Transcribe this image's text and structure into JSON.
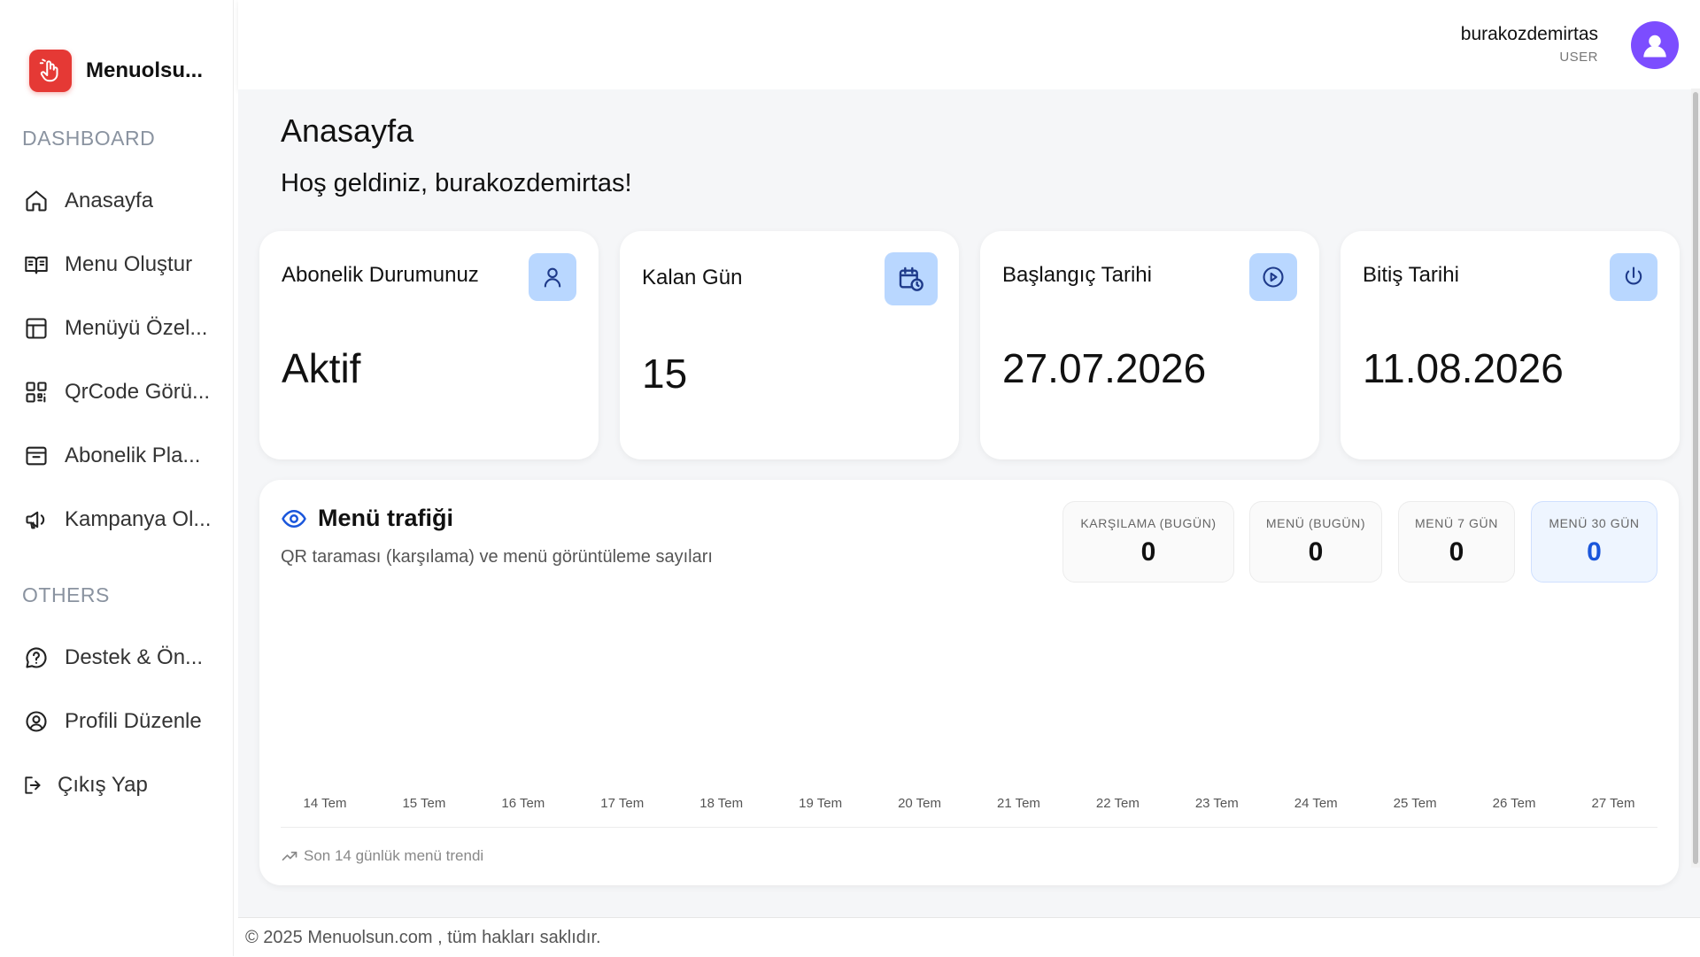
{
  "brand": {
    "name": "Menuolsu...",
    "color": "#e53935"
  },
  "sidebar": {
    "sections": [
      {
        "label": "DASHBOARD"
      },
      {
        "label": "OTHERS"
      }
    ],
    "items": [
      {
        "label": "Anasayfa",
        "icon": "home-icon"
      },
      {
        "label": "Menu Oluştur",
        "icon": "book-icon"
      },
      {
        "label": "Menüyü Özel...",
        "icon": "layout-icon"
      },
      {
        "label": "QrCode Görü...",
        "icon": "qrcode-icon"
      },
      {
        "label": "Abonelik Pla...",
        "icon": "archive-icon"
      },
      {
        "label": "Kampanya Ol...",
        "icon": "megaphone-icon"
      },
      {
        "label": "Destek & Ön...",
        "icon": "help-icon"
      },
      {
        "label": "Profili Düzenle",
        "icon": "user-circle-icon"
      },
      {
        "label": "Çıkış Yap",
        "icon": "logout-icon"
      }
    ]
  },
  "header": {
    "user_name": "burakozdemirtas",
    "user_role": "USER",
    "avatar_color": "#7c4dff"
  },
  "main": {
    "title": "Anasayfa",
    "welcome": "Hoş geldiniz, burakozdemirtas!"
  },
  "stats": [
    {
      "label": "Abonelik Durumunuz",
      "value": "Aktif",
      "icon": "user-icon"
    },
    {
      "label": "Kalan Gün",
      "value": "15",
      "icon": "calendar-clock-icon"
    },
    {
      "label": "Başlangıç Tarihi",
      "value": "27.07.2026",
      "icon": "play-circle-icon"
    },
    {
      "label": "Bitiş Tarihi",
      "value": "11.08.2026",
      "icon": "power-icon"
    }
  ],
  "traffic": {
    "title": "Menü trafiği",
    "subtitle": "QR taraması (karşılama) ve menü görüntüleme sayıları",
    "metrics": [
      {
        "label": "KARŞILAMA (BUGÜN)",
        "value": "0"
      },
      {
        "label": "MENÜ (BUGÜN)",
        "value": "0"
      },
      {
        "label": "MENÜ 7 GÜN",
        "value": "0"
      },
      {
        "label": "MENÜ 30 GÜN",
        "value": "0"
      }
    ],
    "trend_label": "Son 14 günlük menü trendi"
  },
  "chart_data": {
    "type": "line",
    "categories": [
      "14 Tem",
      "15 Tem",
      "16 Tem",
      "17 Tem",
      "18 Tem",
      "19 Tem",
      "20 Tem",
      "21 Tem",
      "22 Tem",
      "23 Tem",
      "24 Tem",
      "25 Tem",
      "26 Tem",
      "27 Tem"
    ],
    "values": [
      0,
      0,
      0,
      0,
      0,
      0,
      0,
      0,
      0,
      0,
      0,
      0,
      0,
      0
    ],
    "title": "",
    "xlabel": "",
    "ylabel": "",
    "grid": false
  },
  "footer": {
    "text": "© 2025 Menuolsun.com , tüm hakları saklıdır."
  },
  "colors": {
    "accent": "#1a56db",
    "icon_bg": "#b9d7ff"
  }
}
